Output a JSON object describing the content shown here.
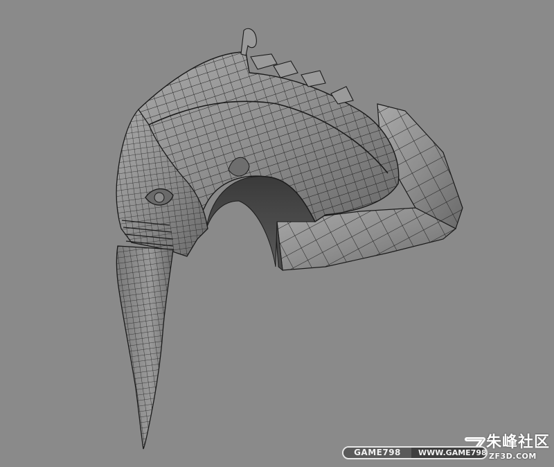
{
  "viewport": {
    "background_color": "#8a8a8a",
    "mesh_fill": "#8f8f8f",
    "mesh_wire": "#1a1a1a"
  },
  "watermark": {
    "badge_left": "GAME798",
    "badge_right": "WWW.GAME798.COM",
    "brand_cn": "朱峰社区",
    "brand_url": "ZF3D.COM",
    "logo_icon": "zf-logo-icon"
  }
}
